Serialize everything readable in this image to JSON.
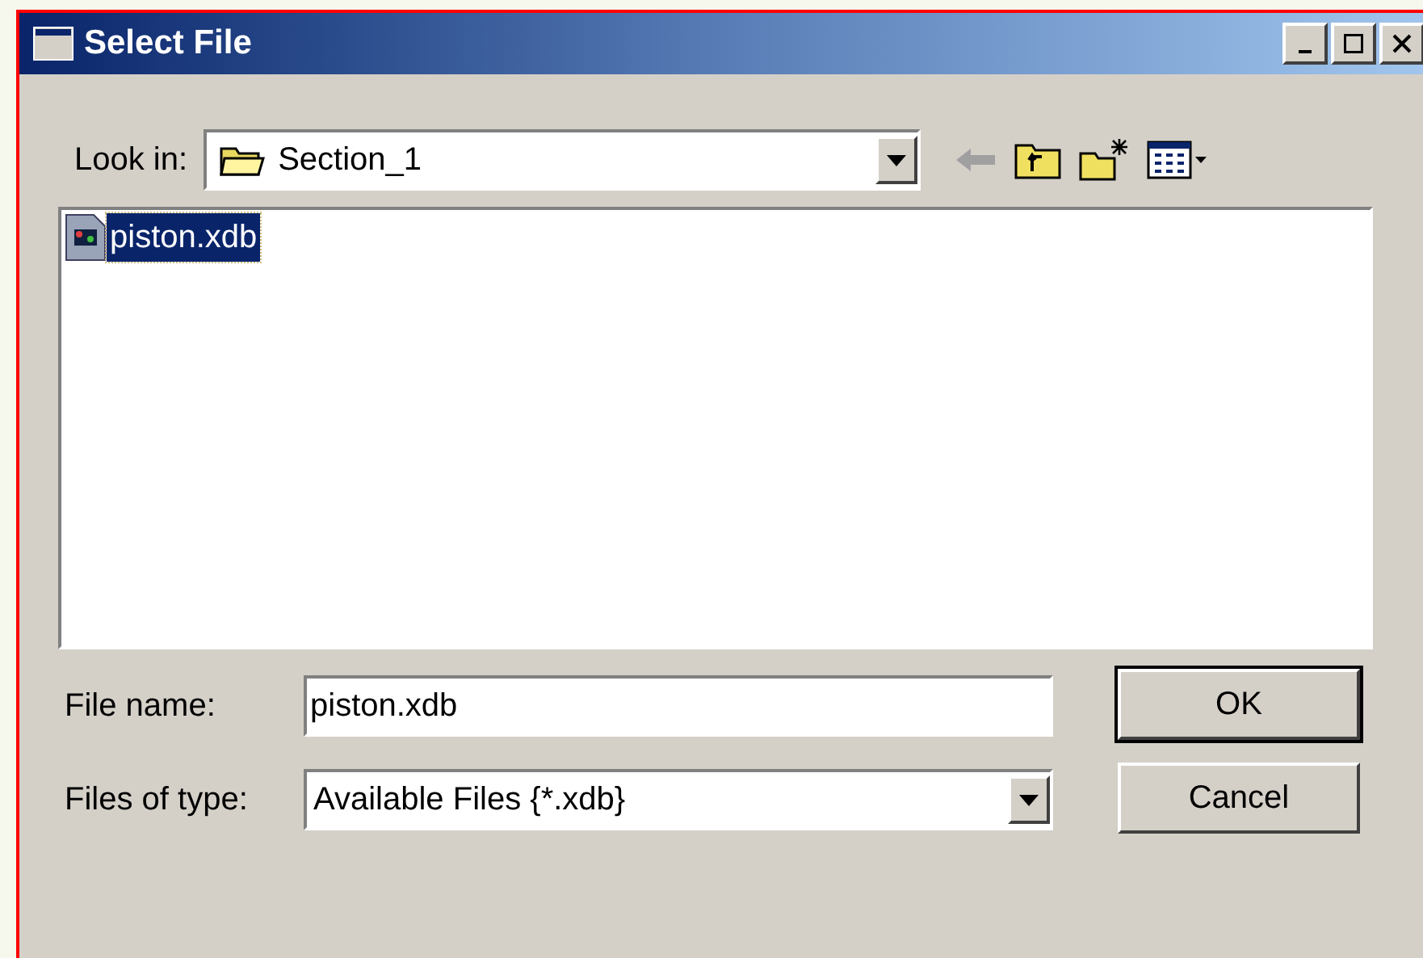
{
  "window": {
    "title": "Select File"
  },
  "look_in": {
    "label": "Look in:",
    "value": "Section_1"
  },
  "files": [
    {
      "name": "piston.xdb",
      "selected": true
    }
  ],
  "file_name": {
    "label": "File name:",
    "value": "piston.xdb"
  },
  "file_type": {
    "label": "Files of type:",
    "value": "Available Files {*.xdb}"
  },
  "buttons": [
    {
      "label": "OK",
      "default": true
    },
    {
      "label": "Cancel",
      "default": false
    }
  ]
}
